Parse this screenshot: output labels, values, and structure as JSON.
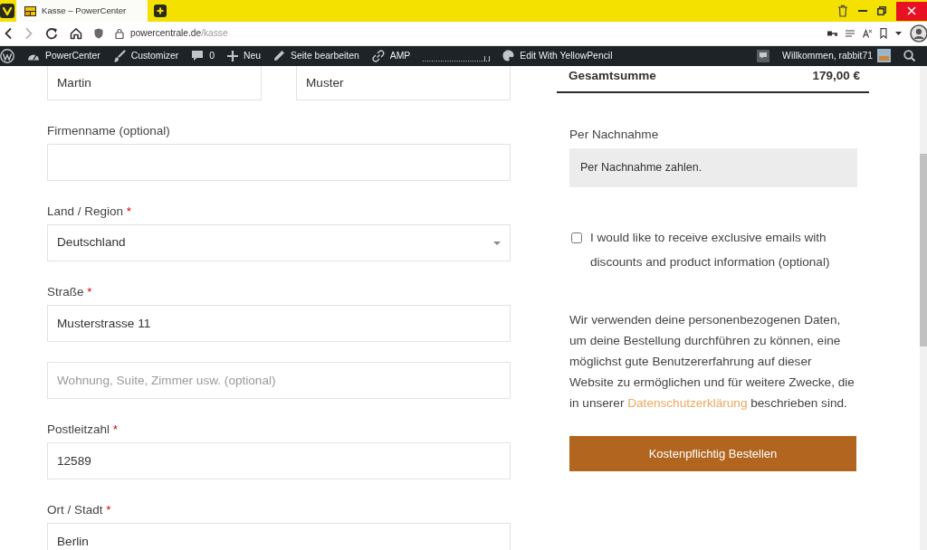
{
  "browser": {
    "tabs": [
      {
        "title": "Kasse – PowerCenter",
        "selected": true
      }
    ],
    "forward": {
      "disabled": true
    },
    "address": {
      "host": "powercentrale.de",
      "path": "/kasse"
    }
  },
  "admin_bar": {
    "left": [
      {
        "kind": "wordpress"
      },
      {
        "kind": "site",
        "label": "PowerCenter"
      },
      {
        "kind": "customizer",
        "label": "Customizer"
      },
      {
        "kind": "comments",
        "label": "0"
      },
      {
        "kind": "new",
        "label": "Neu"
      },
      {
        "kind": "edit",
        "label": "Seite bearbeiten"
      },
      {
        "kind": "amp",
        "label": "AMP"
      },
      {
        "kind": "meter"
      },
      {
        "kind": "yellowpencil",
        "label": "Edit With YellowPencil"
      }
    ],
    "right": [
      {
        "kind": "notice"
      },
      {
        "kind": "account",
        "label": "Willkommen, rabbit71"
      },
      {
        "kind": "search"
      }
    ]
  },
  "checkout": {
    "name_fields": [
      {
        "value": "Martin"
      },
      {
        "value": "Muster"
      }
    ],
    "fields": [
      {
        "kind": "text",
        "label": "Firmenname (optional)"
      },
      {
        "kind": "select",
        "label": "Land / Region",
        "required_mark": "*",
        "value": "Deutschland"
      },
      {
        "kind": "text",
        "label": "Straße",
        "required_mark": "*",
        "value": "Musterstrasse 11"
      },
      {
        "kind": "text",
        "placeholder": "Wohnung, Suite, Zimmer usw. (optional)"
      },
      {
        "kind": "text",
        "label": "Postleitzahl",
        "required_mark": "*",
        "value": "12589"
      },
      {
        "kind": "text",
        "label": "Ort / Stadt",
        "required_mark": "*",
        "value": "Berlin"
      }
    ]
  },
  "order": {
    "total_label": "Gesamtsumme",
    "total": "179,00 €",
    "payment_method": "Per Nachnahme",
    "payment_note": "Per Nachnahme zahlen.",
    "newsletter": {
      "checked": false,
      "label": "I would like to receive exclusive emails with discounts and product information (optional)"
    },
    "privacy": {
      "text": "Wir verwenden deine personenbezogenen Daten, um deine Bestellung durchführen zu können, eine möglichst gute Benutzererfahrung auf dieser Website zu ermöglichen und für weitere Zwecke, die in unserer ",
      "link": "Datenschutzerklärung",
      "after": " beschrieben sind."
    },
    "submit": "Kostenpflichtig Bestellen"
  }
}
